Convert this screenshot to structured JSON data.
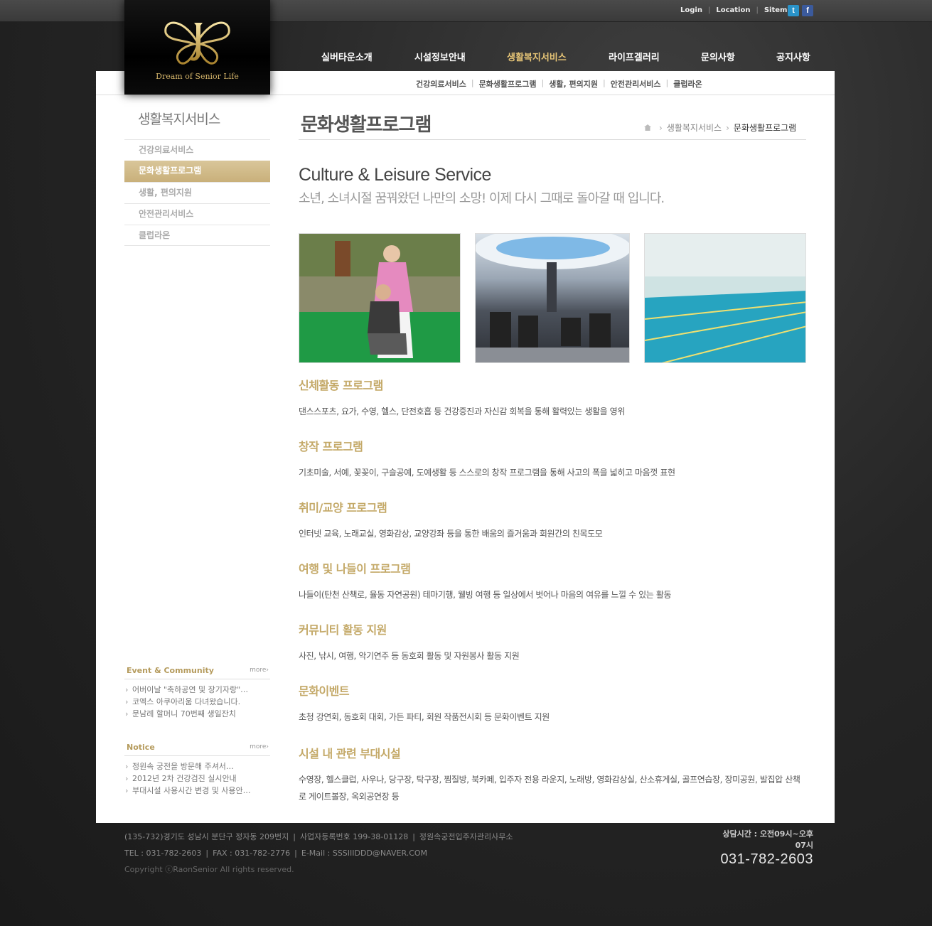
{
  "toplinks": {
    "login": "Login",
    "location": "Location",
    "sitemap": "Sitemap",
    "twitter": "t",
    "facebook": "f"
  },
  "brand": {
    "slogan": "Dream of Senior Life",
    "accent": "#c4a968"
  },
  "gnav": [
    "실버타운소개",
    "시설정보안내",
    "생활복지서비스",
    "라이프겔러리",
    "문의사항",
    "공지사항"
  ],
  "subnav": [
    "건강의료서비스",
    "문화생활프로그램",
    "생활, 편의지원",
    "안전관리서비스",
    "클럽라온"
  ],
  "lnb": {
    "title": "생활복지서비스",
    "items": [
      "건강의료서비스",
      "문화생활프로그램",
      "생활, 편의지원",
      "안전관리서비스",
      "클럽라온"
    ]
  },
  "event": {
    "title": "Event & Community",
    "more": "more›",
    "items": [
      "어버이날 \"축하공연 및 장기자랑\"…",
      "코엑스 아쿠아리움 다녀왔습니다.",
      "문남례 할머니 70번째 생일잔치"
    ]
  },
  "notice": {
    "title": "Notice",
    "more": "more›",
    "items": [
      "정원속 궁전을 방문해 주셔서…",
      "2012년 2차 건강검진 실시안내",
      "부대시설 사용시간 변경 및 사용안…"
    ]
  },
  "page": {
    "title": "문화생활프로그램",
    "breadcrumb": [
      "생활복지서비스",
      "문화생활프로그램"
    ],
    "lead_en": "Culture & Leisure Service",
    "lead_ko": "소년, 소녀시절 꿈꿔왔던 나만의 소망! 이제 다시 그때로 돌아갈 때 입니다."
  },
  "sections": [
    {
      "title": "신체활동 프로그램",
      "desc": "댄스스포츠, 요가, 수영, 헬스, 단전호흡 등 건강증진과 자신감 회복을 통해 활력있는 생활을 영위"
    },
    {
      "title": "창작 프로그램",
      "desc": "기초미술, 서예, 꽃꽂이, 구슬공예, 도예생활 등 스스로의 창작 프로그램을 통해 사고의 폭을 넓히고 마음껏 표현"
    },
    {
      "title": "취미/교양 프로그램",
      "desc": "인터넷 교육, 노래교실, 영화감상, 교양강좌 등을 통한 배움의 즐거움과 회원간의 친목도모"
    },
    {
      "title": "여행 및 나들이 프로그램",
      "desc": "나들이(탄천 산책로, 율동 자연공원) 테마기행, 웰빙 여행 등 일상에서 벗어나 마음의 여유를 느낄 수 있는 활동"
    },
    {
      "title": "커뮤니티 활동 지원",
      "desc": "사진, 낚시, 여행, 악기연주 등 동호회 활동 및 자원봉사 활동 지원"
    },
    {
      "title": "문화이벤트",
      "desc": "초청 강연회, 동호회 대회, 가든 파티, 회원 작품전시회 등 문화이벤트 지원"
    },
    {
      "title": "시설 내 관련 부대시설",
      "desc": "수영장, 헬스클럽, 사우나, 당구장, 탁구장, 찜질방, 북카페, 입주자 전용 라운지, 노래방, 영화감상실, 산소휴게실, 골프연습장, 장미공원, 발집압 산책로 게이트볼장, 옥외공연장 등"
    }
  ],
  "footer": {
    "address": "(135-732)경기도 성남시 분단구 정자동 209번지",
    "bizno": "사업자등록번호 199-38-01128",
    "office": "정원속궁전입주자관리사무소",
    "tel": "TEL : 031-782-2603",
    "fax": "FAX : 031-782-2776",
    "email": "E-Mail : SSSIIIDDD@NAVER.COM",
    "copyright": "Copyright ⓒRaonSenior All rights reserved.",
    "hours": "상담시간 : 오전09시~오후07시",
    "phone": "031-782-2603"
  }
}
